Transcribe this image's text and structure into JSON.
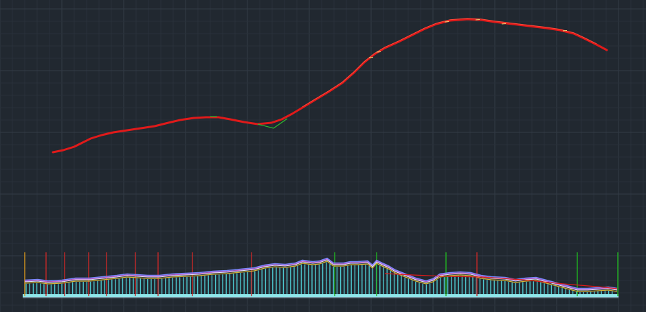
{
  "viewport": {
    "kind": "cad-model-space",
    "background": "#212830",
    "grid_minor": "#29313a",
    "grid_major": "#323b46"
  },
  "colors": {
    "alignment": "#e01a1a",
    "construction": "#2fbf2f",
    "annotation": "#e8e07a",
    "station_red": "#c62828",
    "station_green": "#1fb31f",
    "station_orange": "#d4941e",
    "hatch": "#4ec8cf",
    "profile_existing": "#d8b638",
    "profile_magenta": "#c85ac8",
    "profile_blue": "#7c88ff",
    "profile_white": "#dfe8ff",
    "datum": "#8fe6ea"
  },
  "layers": {
    "plan": "alignment-plan",
    "profile": "profile-band"
  }
}
